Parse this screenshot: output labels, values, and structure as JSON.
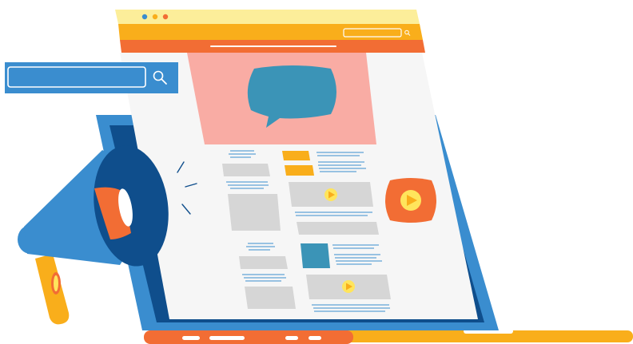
{
  "colors": {
    "window_yellow": "#FCEE9A",
    "window_orange": "#F9AE1B",
    "header_red_orange": "#F26D34",
    "hero_pink": "#F9ACA4",
    "chat_blue": "#3B94B7",
    "laptop_blue": "#3A8DCF",
    "screen_dark_blue": "#0F4E8C",
    "page_bg": "#F6F6F6",
    "block_gray": "#D6D6D6",
    "line_blue": "#3A8DCF",
    "play_yellow": "#FFE55C",
    "base_orange": "#F26D34",
    "base_yellow": "#F9AE1B",
    "megaphone_blue": "#3A8DCF",
    "megaphone_dark": "#0F4E8C",
    "megaphone_orange": "#F26D34",
    "handle_yellow": "#F9AE1B",
    "dot_blue": "#3A8DCF",
    "dot_yellow": "#F9AE1B",
    "dot_red": "#F26D34",
    "search_bar_blue": "#3A8DCF"
  },
  "icons": {
    "search": "search-icon",
    "chat": "chat-bubble-icon",
    "play": "play-icon",
    "megaphone": "megaphone-icon"
  }
}
